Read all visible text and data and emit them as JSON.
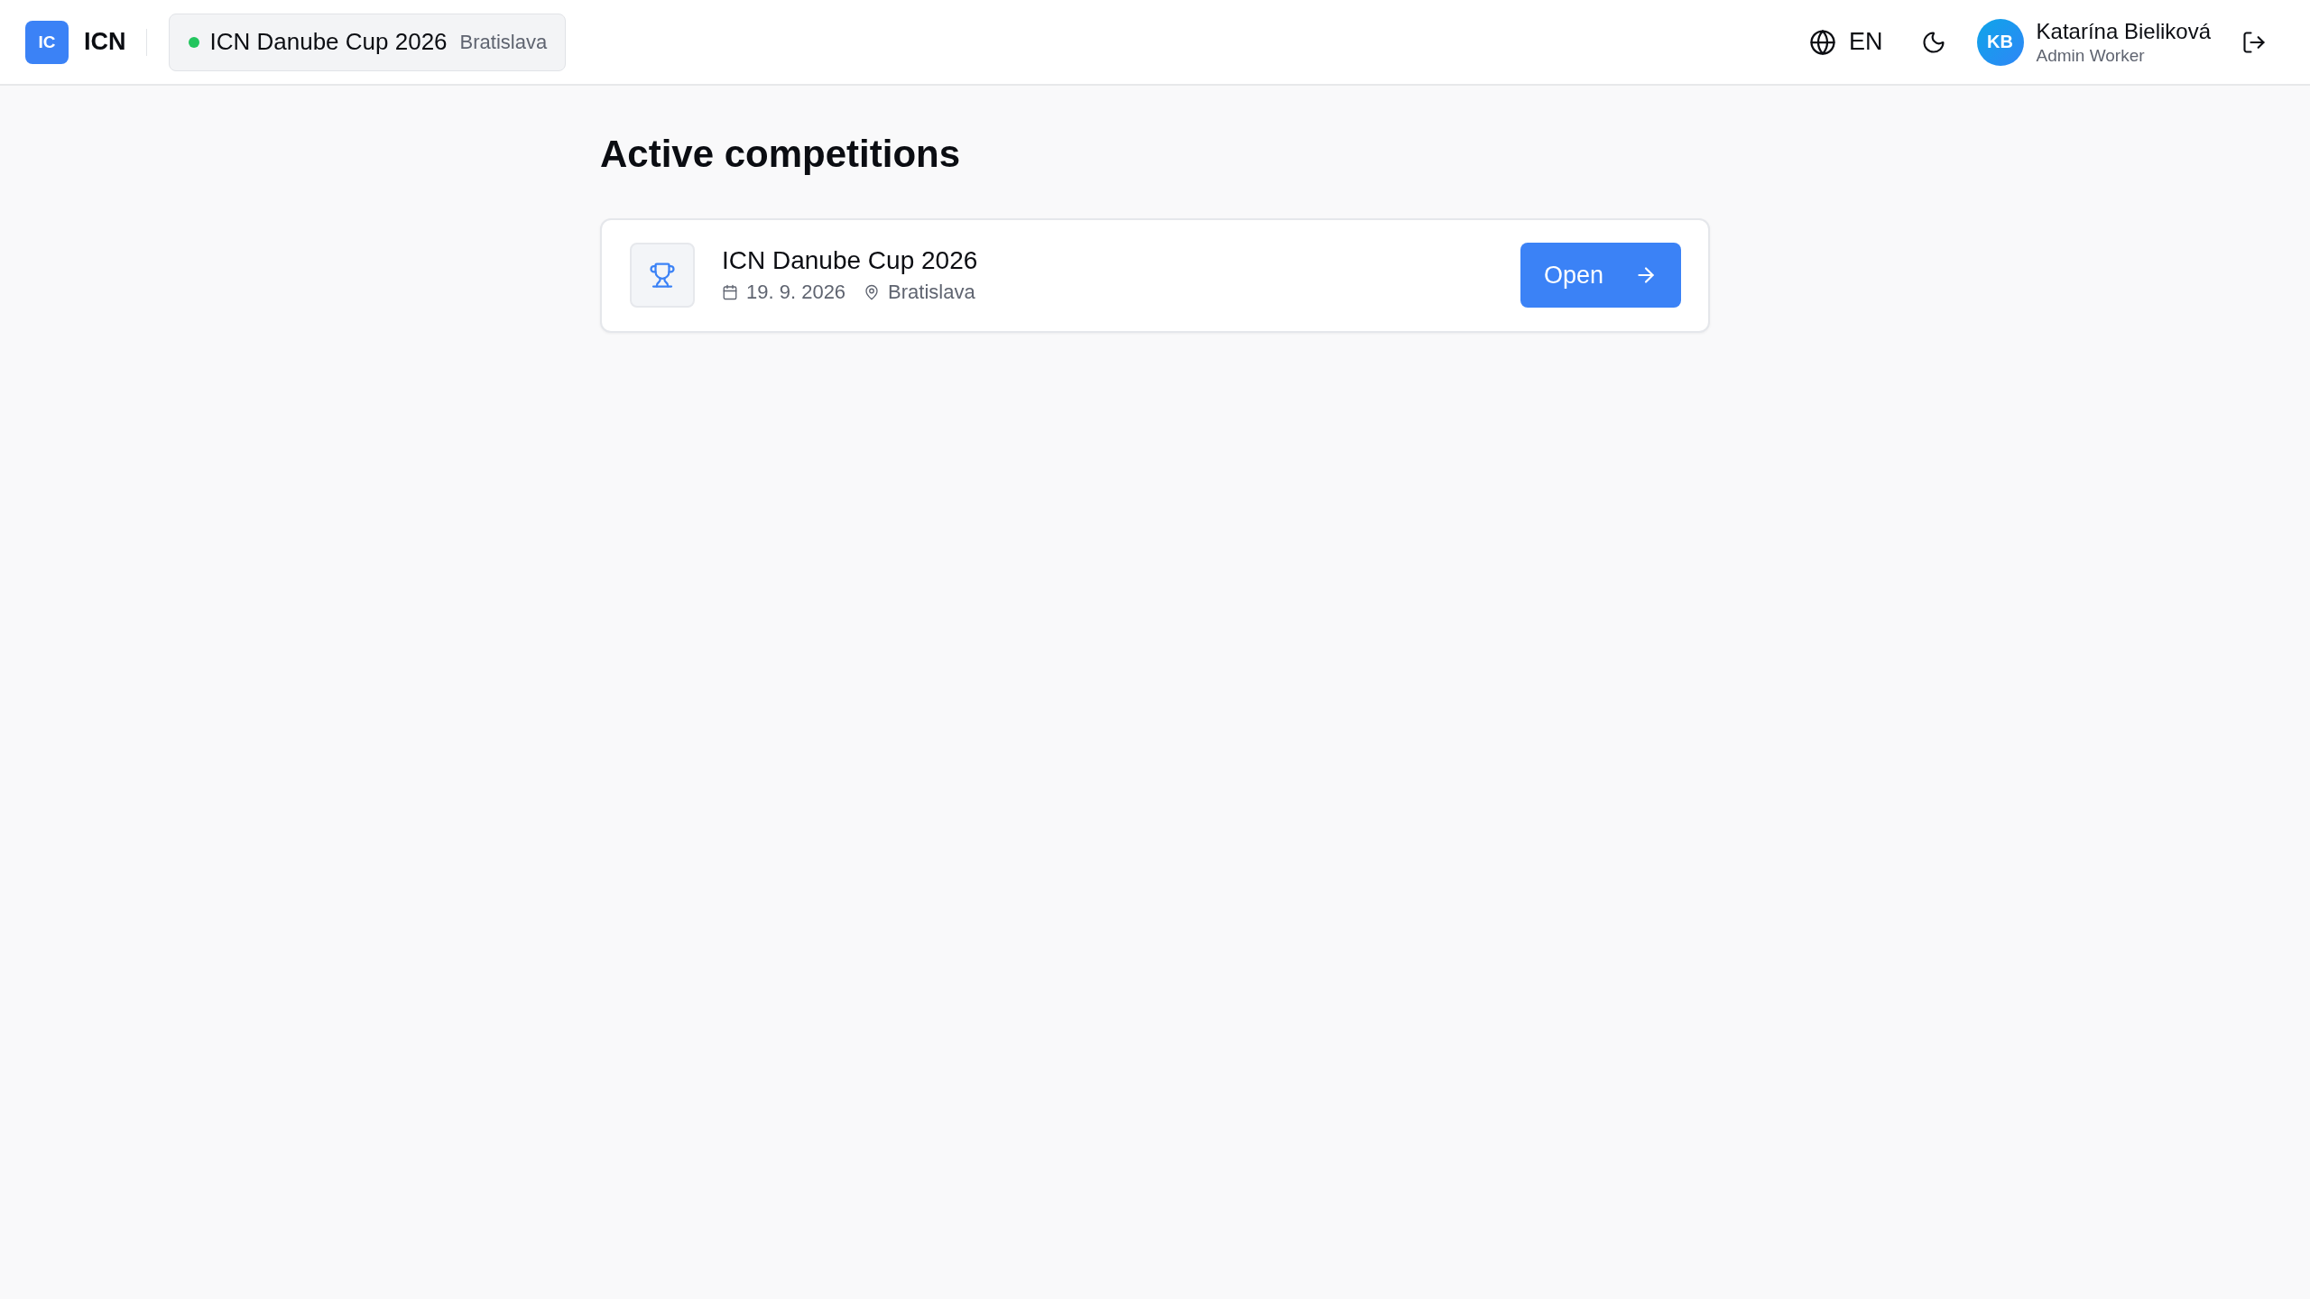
{
  "header": {
    "logo": {
      "mark": "IC",
      "name": "ICN"
    },
    "current_competition": {
      "name": "ICN Danube Cup 2026",
      "city": "Bratislava",
      "active": true
    },
    "language": "EN",
    "user": {
      "initials": "KB",
      "name": "Katarína Bieliková",
      "role": "Admin Worker"
    }
  },
  "page": {
    "title": "Active competitions",
    "competitions": [
      {
        "name": "ICN Danube Cup 2026",
        "date": "19. 9. 2026",
        "location": "Bratislava",
        "action": "Open"
      }
    ]
  }
}
